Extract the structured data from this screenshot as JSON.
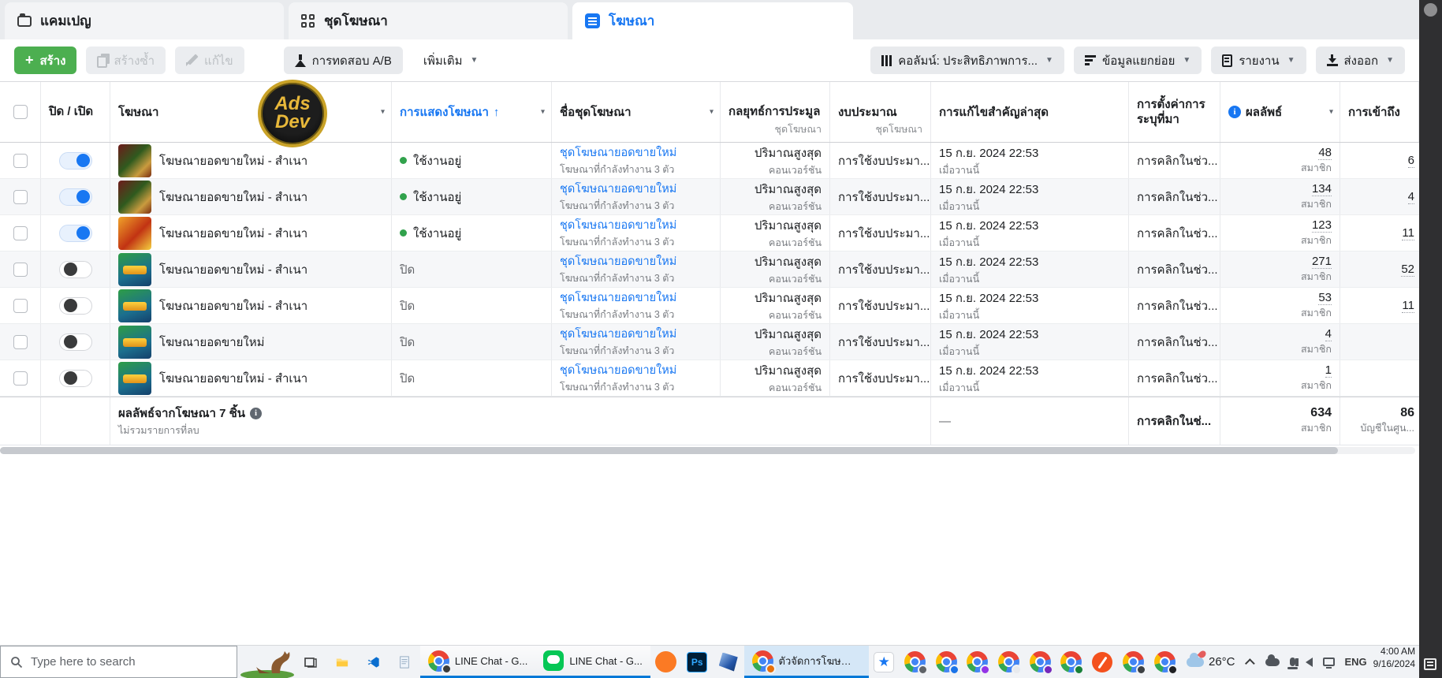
{
  "tabs": {
    "campaigns": "แคมเปญ",
    "adsets": "ชุดโฆษณา",
    "ads": "โฆษณา"
  },
  "toolbar": {
    "create": "สร้าง",
    "duplicate": "สร้างซ้ำ",
    "edit": "แก้ไข",
    "ab_test": "การทดสอบ A/B",
    "more": "เพิ่มเติม",
    "columns": "คอลัมน์: ประสิทธิภาพการ...",
    "breakdown": "ข้อมูลแยกย่อย",
    "reports": "รายงาน",
    "export": "ส่งออก"
  },
  "watermark": {
    "line1": "Ads",
    "line2": "Dev"
  },
  "table": {
    "headers": {
      "on_off": "ปิด / เปิด",
      "ads": "โฆษณา",
      "delivery": "การแสดงโฆษณา",
      "sort_arrow": "↑",
      "adset_name": "ชื่อชุดโฆษณา",
      "bid_strategy": "กลยุทธ์การประมูล",
      "bid_sub": "ชุดโฆษณา",
      "budget": "งบประมาณ",
      "budget_sub": "ชุดโฆษณา",
      "last_edit": "การแก้ไขสำคัญล่าสุด",
      "attribution": "การตั้งค่าการระบุที่มา",
      "results": "ผลลัพธ์",
      "info": "i",
      "reach": "การเข้าถึง"
    },
    "rows": [
      {
        "toggle": "on",
        "thumb": "red",
        "name": "โฆษณายอดขายใหม่ - สำเนา",
        "delivery_state": "active",
        "delivery": "ใช้งานอยู่",
        "adset_link": "ชุดโฆษณายอดขายใหม่",
        "adset_sub": "โฆษณาที่กำลังทำงาน 3 ตัว",
        "bid": "ปริมาณสูงสุด",
        "bid_sub": "คอนเวอร์ชัน",
        "budget": "การใช้งบประมา...",
        "edited": "15 ก.ย. 2024 22:53",
        "edited_sub": "เมื่อวานนี้",
        "attribution": "การคลิกในช่ว...",
        "result": "48",
        "result_sub": "สมาชิก",
        "reach": "6"
      },
      {
        "toggle": "on",
        "thumb": "red",
        "name": "โฆษณายอดขายใหม่ - สำเนา",
        "delivery_state": "active",
        "delivery": "ใช้งานอยู่",
        "adset_link": "ชุดโฆษณายอดขายใหม่",
        "adset_sub": "โฆษณาที่กำลังทำงาน 3 ตัว",
        "bid": "ปริมาณสูงสุด",
        "bid_sub": "คอนเวอร์ชัน",
        "budget": "การใช้งบประมา...",
        "edited": "15 ก.ย. 2024 22:53",
        "edited_sub": "เมื่อวานนี้",
        "attribution": "การคลิกในช่ว...",
        "result": "134",
        "result_sub": "สมาชิก",
        "reach": "4"
      },
      {
        "toggle": "on",
        "thumb": "orange",
        "name": "โฆษณายอดขายใหม่ - สำเนา",
        "delivery_state": "active",
        "delivery": "ใช้งานอยู่",
        "adset_link": "ชุดโฆษณายอดขายใหม่",
        "adset_sub": "โฆษณาที่กำลังทำงาน 3 ตัว",
        "bid": "ปริมาณสูงสุด",
        "bid_sub": "คอนเวอร์ชัน",
        "budget": "การใช้งบประมา...",
        "edited": "15 ก.ย. 2024 22:53",
        "edited_sub": "เมื่อวานนี้",
        "attribution": "การคลิกในช่ว...",
        "result": "123",
        "result_sub": "สมาชิก",
        "reach": "11"
      },
      {
        "toggle": "off",
        "thumb": "green",
        "name": "โฆษณายอดขายใหม่ - สำเนา",
        "delivery_state": "off",
        "delivery": "ปิด",
        "adset_link": "ชุดโฆษณายอดขายใหม่",
        "adset_sub": "โฆษณาที่กำลังทำงาน 3 ตัว",
        "bid": "ปริมาณสูงสุด",
        "bid_sub": "คอนเวอร์ชัน",
        "budget": "การใช้งบประมา...",
        "edited": "15 ก.ย. 2024 22:53",
        "edited_sub": "เมื่อวานนี้",
        "attribution": "การคลิกในช่ว...",
        "result": "271",
        "result_sub": "สมาชิก",
        "reach": "52"
      },
      {
        "toggle": "off",
        "thumb": "green",
        "name": "โฆษณายอดขายใหม่ - สำเนา",
        "delivery_state": "off",
        "delivery": "ปิด",
        "adset_link": "ชุดโฆษณายอดขายใหม่",
        "adset_sub": "โฆษณาที่กำลังทำงาน 3 ตัว",
        "bid": "ปริมาณสูงสุด",
        "bid_sub": "คอนเวอร์ชัน",
        "budget": "การใช้งบประมา...",
        "edited": "15 ก.ย. 2024 22:53",
        "edited_sub": "เมื่อวานนี้",
        "attribution": "การคลิกในช่ว...",
        "result": "53",
        "result_sub": "สมาชิก",
        "reach": "11"
      },
      {
        "toggle": "off",
        "thumb": "green",
        "name": "โฆษณายอดขายใหม่",
        "delivery_state": "off",
        "delivery": "ปิด",
        "adset_link": "ชุดโฆษณายอดขายใหม่",
        "adset_sub": "โฆษณาที่กำลังทำงาน 3 ตัว",
        "bid": "ปริมาณสูงสุด",
        "bid_sub": "คอนเวอร์ชัน",
        "budget": "การใช้งบประมา...",
        "edited": "15 ก.ย. 2024 22:53",
        "edited_sub": "เมื่อวานนี้",
        "attribution": "การคลิกในช่ว...",
        "result": "4",
        "result_sub": "สมาชิก",
        "reach": ""
      },
      {
        "toggle": "off",
        "thumb": "green",
        "name": "โฆษณายอดขายใหม่ - สำเนา",
        "delivery_state": "off",
        "delivery": "ปิด",
        "adset_link": "ชุดโฆษณายอดขายใหม่",
        "adset_sub": "โฆษณาที่กำลังทำงาน 3 ตัว",
        "bid": "ปริมาณสูงสุด",
        "bid_sub": "คอนเวอร์ชัน",
        "budget": "การใช้งบประมา...",
        "edited": "15 ก.ย. 2024 22:53",
        "edited_sub": "เมื่อวานนี้",
        "attribution": "การคลิกในช่ว...",
        "result": "1",
        "result_sub": "สมาชิก",
        "reach": ""
      }
    ],
    "summary": {
      "title": "ผลลัพธ์จากโฆษณา 7 ชิ้น",
      "subtitle": "ไม่รวมรายการที่ลบ",
      "last_edit": "—",
      "attribution": "การคลิกในช่...",
      "result": "634",
      "result_sub": "สมาชิก",
      "reach": "86",
      "reach_sub": "บัญชีในศูน..."
    }
  },
  "taskbar": {
    "search_placeholder": "Type here to search",
    "windows": [
      {
        "label": "LINE Chat - G..."
      },
      {
        "label": "LINE Chat - G..."
      },
      {
        "label": "ตัวจัดการโฆษณา..."
      }
    ],
    "photoshop_label": "Ps",
    "star_glyph": "★",
    "weather": "26°C",
    "language": "ENG",
    "time": "4:00 AM",
    "date": "9/16/2024"
  }
}
